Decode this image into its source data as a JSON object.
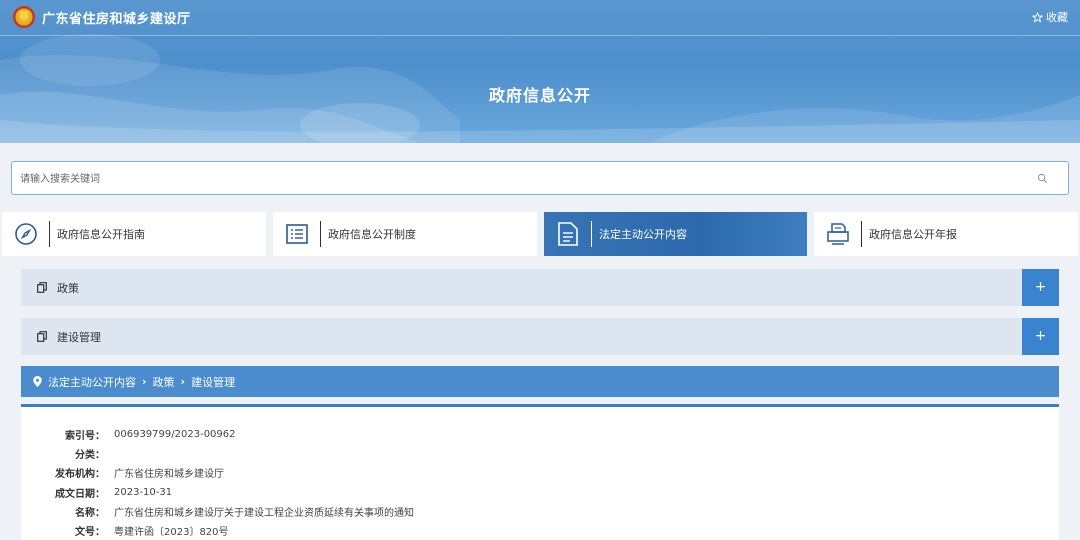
{
  "header": {
    "site_title": "广东省住房和城乡建设厅",
    "favorite_label": "收藏",
    "page_heading": "政府信息公开"
  },
  "search": {
    "placeholder": "请输入搜索关键词",
    "value": ""
  },
  "tabs": [
    {
      "label": "政府信息公开指南",
      "icon": "compass-icon",
      "active": false
    },
    {
      "label": "政府信息公开制度",
      "icon": "list-icon",
      "active": false
    },
    {
      "label": "法定主动公开内容",
      "icon": "document-icon",
      "active": true
    },
    {
      "label": "政府信息公开年报",
      "icon": "printer-icon",
      "active": false
    }
  ],
  "accordion": [
    {
      "label": "政策",
      "expand": "+"
    },
    {
      "label": "建设管理",
      "expand": "+"
    }
  ],
  "breadcrumb": {
    "items": [
      "法定主动公开内容",
      "政策",
      "建设管理"
    ]
  },
  "details": {
    "rows": [
      {
        "key": "索引号：",
        "value": "006939799/2023-00962"
      },
      {
        "key": "分类：",
        "value": ""
      },
      {
        "key": "发布机构：",
        "value": "广东省住房和城乡建设厅"
      },
      {
        "key": "成文日期：",
        "value": "2023-10-31"
      },
      {
        "key": "名称：",
        "value": "广东省住房和城乡建设厅关于建设工程企业资质延续有关事项的通知"
      },
      {
        "key": "文号：",
        "value": "粤建许函〔2023〕820号"
      }
    ]
  },
  "colors": {
    "banner": "#4d8fcc",
    "active_tab": "#2c6aad",
    "accordion_bg": "#dde6f0",
    "expand_button": "#3a84cf",
    "breadcrumb_bg": "#4a8ccd"
  }
}
